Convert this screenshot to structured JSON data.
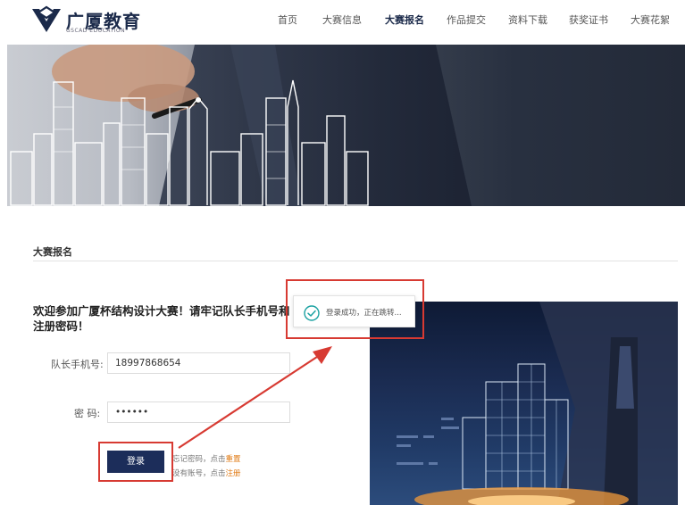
{
  "header": {
    "logo_text": "广厦教育",
    "logo_sub": "GSCAD EDUCATION",
    "nav": [
      {
        "label": "首页",
        "active": false
      },
      {
        "label": "大赛信息",
        "active": false
      },
      {
        "label": "大赛报名",
        "active": true
      },
      {
        "label": "作品提交",
        "active": false
      },
      {
        "label": "资料下载",
        "active": false
      },
      {
        "label": "获奖证书",
        "active": false
      },
      {
        "label": "大赛花絮",
        "active": false
      }
    ]
  },
  "section": {
    "title": "大赛报名"
  },
  "form": {
    "welcome": "欢迎参加广厦杯结构设计大赛！请牢记队长手机号和注册密码！",
    "phone_label": "队长手机号:",
    "phone_value": "18997868654",
    "password_label": "密  码:",
    "password_value": "••••••",
    "login_label": "登录",
    "forgot_prefix": "忘记密码，点击",
    "forgot_link": "重置",
    "register_prefix": "没有账号，点击",
    "register_link": "注册"
  },
  "toast": {
    "message": "登录成功，正在跳转..."
  },
  "colors": {
    "brand": "#1c2d5a",
    "link": "#e07b16",
    "annotation": "#d73a32",
    "success": "#1aa1a1"
  }
}
